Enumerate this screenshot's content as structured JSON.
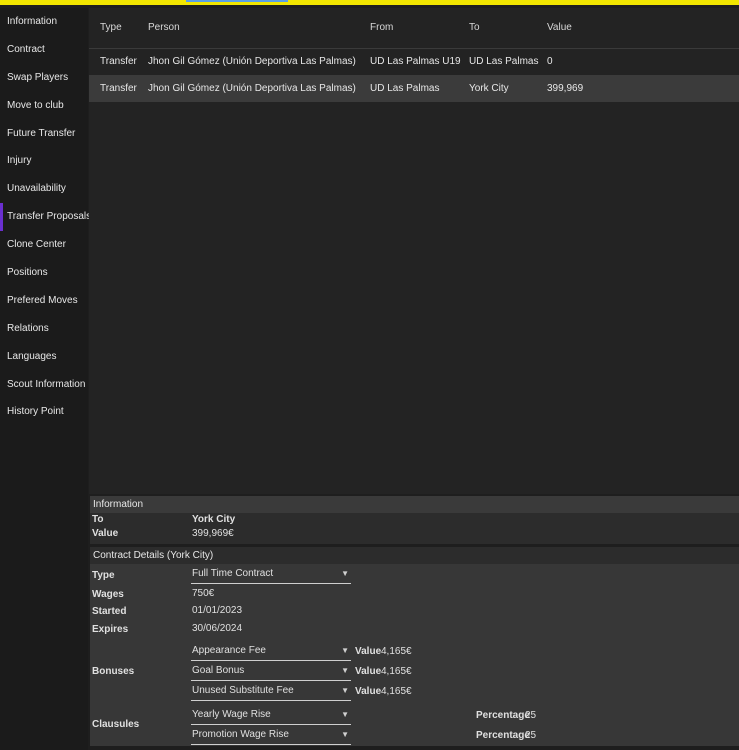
{
  "sidebar": {
    "items": [
      {
        "label": "Information"
      },
      {
        "label": "Contract"
      },
      {
        "label": "Swap Players"
      },
      {
        "label": "Move to club"
      },
      {
        "label": "Future Transfer"
      },
      {
        "label": "Injury"
      },
      {
        "label": "Unavailability"
      },
      {
        "label": "Transfer Proposals"
      },
      {
        "label": "Clone Center"
      },
      {
        "label": "Positions"
      },
      {
        "label": "Prefered Moves"
      },
      {
        "label": "Relations"
      },
      {
        "label": "Languages"
      },
      {
        "label": "Scout Information"
      },
      {
        "label": "History Point"
      }
    ],
    "active_index": 7
  },
  "grid": {
    "columns": [
      "Type",
      "Person",
      "From",
      "To",
      "Value"
    ],
    "rows": [
      {
        "type": "Transfer",
        "person": "Jhon Gil Gómez (Unión Deportiva Las Palmas)",
        "from": "UD Las Palmas U19",
        "to": "UD Las Palmas",
        "value": "0"
      },
      {
        "type": "Transfer",
        "person": "Jhon Gil Gómez (Unión Deportiva Las Palmas)",
        "from": "UD Las Palmas",
        "to": "York City",
        "value": "399,969"
      }
    ]
  },
  "information": {
    "title": "Information",
    "to_label": "To",
    "to_value": "York City",
    "value_label": "Value",
    "value_value": "399,969€"
  },
  "contract": {
    "title": "Contract Details (York City)",
    "type_label": "Type",
    "type_value": "Full Time Contract",
    "wages_label": "Wages",
    "wages_value": "750€",
    "started_label": "Started",
    "started_value": "01/01/2023",
    "expires_label": "Expires",
    "expires_value": "30/06/2024",
    "bonuses_label": "Bonuses",
    "bonuses": [
      {
        "name": "Appearance Fee",
        "value_label": "Value",
        "value": "4,165€"
      },
      {
        "name": "Goal Bonus",
        "value_label": "Value",
        "value": "4,165€"
      },
      {
        "name": "Unused Substitute Fee",
        "value_label": "Value",
        "value": "4,165€"
      }
    ],
    "clausules_label": "Clausules",
    "clausules": [
      {
        "name": "Yearly Wage Rise",
        "pct_label": "Percentage",
        "pct": "25"
      },
      {
        "name": "Promotion Wage Rise",
        "pct_label": "Percentage",
        "pct": "25"
      }
    ]
  }
}
